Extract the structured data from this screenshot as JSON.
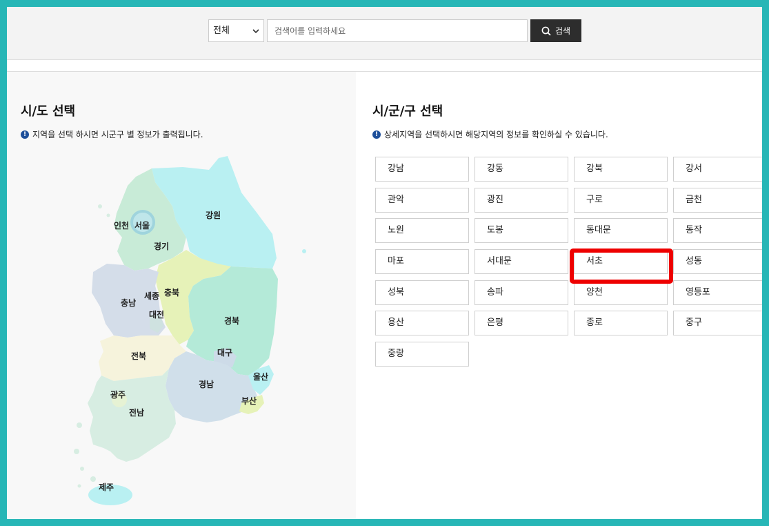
{
  "search": {
    "select_value": "전체",
    "placeholder": "검색어를 입력하세요",
    "button_label": "검색"
  },
  "left_panel": {
    "title": "시/도 선택",
    "note": "지역을 선택 하시면 시군구 별 정보가 출력됩니다.",
    "regions": {
      "incheon": "인천",
      "seoul": "서울",
      "gyeonggi": "경기",
      "gangwon": "강원",
      "chungnam": "충남",
      "sejong": "세종",
      "chungbuk": "충북",
      "daejeon": "대전",
      "gyeongbuk": "경북",
      "daegu": "대구",
      "jeonbuk": "전북",
      "gwangju": "광주",
      "jeonnam": "전남",
      "gyeongnam": "경남",
      "ulsan": "울산",
      "busan": "부산",
      "jeju": "제주"
    }
  },
  "right_panel": {
    "title": "시/군/구 선택",
    "note": "상세지역을 선택하시면 해당지역의 정보를 확인하실 수 있습니다.",
    "districts": [
      "강남",
      "강동",
      "강북",
      "강서",
      "관악",
      "광진",
      "구로",
      "금천",
      "노원",
      "도봉",
      "동대문",
      "동작",
      "마포",
      "서대문",
      "서초",
      "성동",
      "성북",
      "송파",
      "양천",
      "영등포",
      "용산",
      "은평",
      "종로",
      "중구",
      "중랑"
    ],
    "highlighted": "서초"
  },
  "colors": {
    "frame": "#27b6b6",
    "highlight": "#ee0000",
    "search_button": "#2d2d2d"
  }
}
